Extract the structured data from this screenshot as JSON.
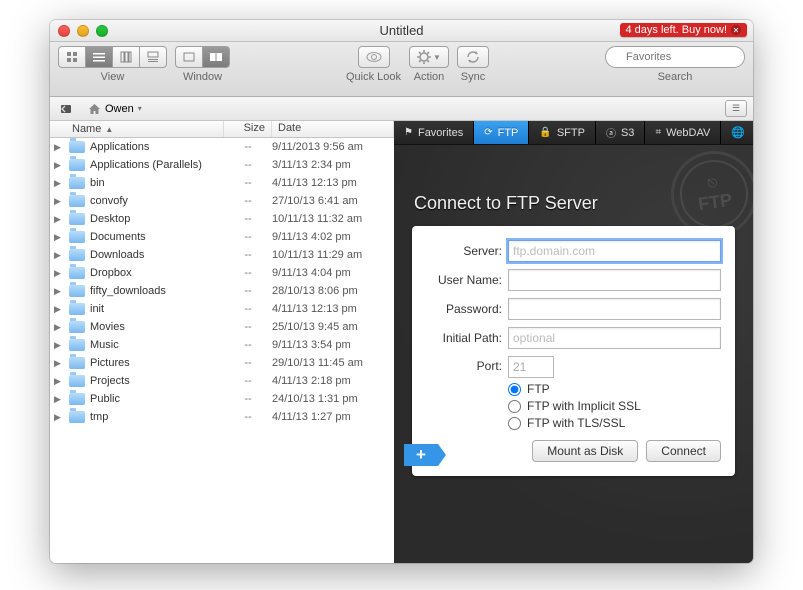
{
  "window": {
    "title": "Untitled"
  },
  "trial": {
    "text": "4 days left. Buy now!"
  },
  "toolbar": {
    "view_label": "View",
    "window_label": "Window",
    "quicklook_label": "Quick Look",
    "action_label": "Action",
    "sync_label": "Sync",
    "search_placeholder": "Favorites",
    "search_label": "Search"
  },
  "pathbar": {
    "user": "Owen"
  },
  "columns": {
    "name": "Name",
    "size": "Size",
    "date": "Date"
  },
  "files": [
    {
      "name": "Applications",
      "size": "--",
      "date": "9/11/2013 9:56 am"
    },
    {
      "name": "Applications (Parallels)",
      "size": "--",
      "date": "3/11/13 2:34 pm"
    },
    {
      "name": "bin",
      "size": "--",
      "date": "4/11/13 12:13 pm"
    },
    {
      "name": "convofy",
      "size": "--",
      "date": "27/10/13 6:41 am"
    },
    {
      "name": "Desktop",
      "size": "--",
      "date": "10/11/13 11:32 am"
    },
    {
      "name": "Documents",
      "size": "--",
      "date": "9/11/13 4:02 pm"
    },
    {
      "name": "Downloads",
      "size": "--",
      "date": "10/11/13 11:29 am"
    },
    {
      "name": "Dropbox",
      "size": "--",
      "date": "9/11/13 4:04 pm"
    },
    {
      "name": "fifty_downloads",
      "size": "--",
      "date": "28/10/13 8:06 pm"
    },
    {
      "name": "init",
      "size": "--",
      "date": "4/11/13 12:13 pm"
    },
    {
      "name": "Movies",
      "size": "--",
      "date": "25/10/13 9:45 am"
    },
    {
      "name": "Music",
      "size": "--",
      "date": "9/11/13 3:54 pm"
    },
    {
      "name": "Pictures",
      "size": "--",
      "date": "29/10/13 11:45 am"
    },
    {
      "name": "Projects",
      "size": "--",
      "date": "4/11/13 2:18 pm"
    },
    {
      "name": "Public",
      "size": "--",
      "date": "24/10/13 1:31 pm"
    },
    {
      "name": "tmp",
      "size": "--",
      "date": "4/11/13 1:27 pm"
    }
  ],
  "right_tabs": [
    {
      "id": "favorites",
      "label": "Favorites",
      "icon": "flag"
    },
    {
      "id": "ftp",
      "label": "FTP",
      "icon": "reload",
      "active": true
    },
    {
      "id": "sftp",
      "label": "SFTP",
      "icon": "lock"
    },
    {
      "id": "s3",
      "label": "S3",
      "icon": "a"
    },
    {
      "id": "webdav",
      "label": "WebDAV",
      "icon": "disk"
    }
  ],
  "ftp": {
    "heading": "Connect to FTP Server",
    "stamp": "FTP",
    "labels": {
      "server": "Server:",
      "user": "User Name:",
      "password": "Password:",
      "initial": "Initial Path:",
      "port": "Port:"
    },
    "server_placeholder": "ftp.domain.com",
    "initial_placeholder": "optional",
    "port_value": "21",
    "radios": {
      "ftp": "FTP",
      "implicit": "FTP with Implicit SSL",
      "tls": "FTP with TLS/SSL"
    },
    "mount_btn": "Mount as Disk",
    "connect_btn": "Connect"
  }
}
